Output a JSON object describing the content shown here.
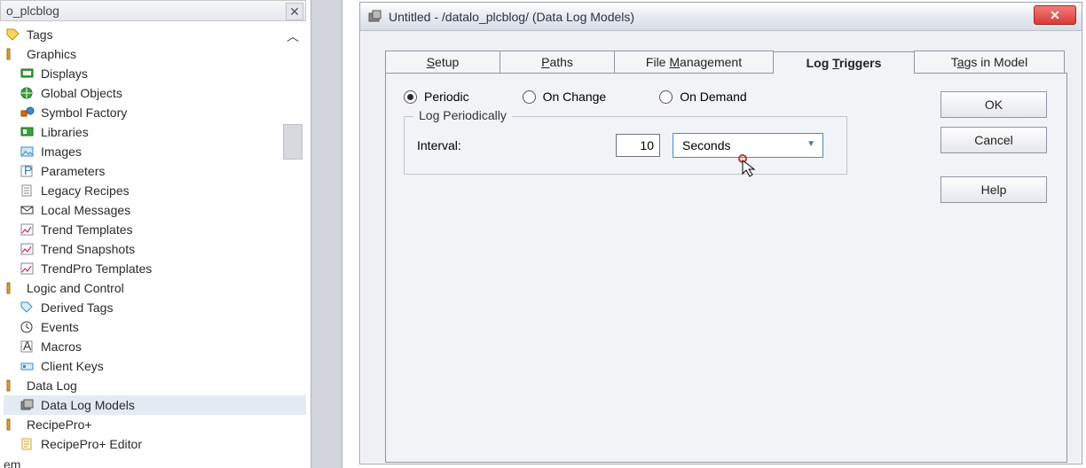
{
  "left_pane": {
    "title": "o_plcblog",
    "items": [
      {
        "label": "Tags",
        "indent": false,
        "icon": "tag"
      },
      {
        "label": "Graphics",
        "indent": false,
        "icon": "folder"
      },
      {
        "label": "Displays",
        "indent": true,
        "icon": "display"
      },
      {
        "label": "Global Objects",
        "indent": true,
        "icon": "globe"
      },
      {
        "label": "Symbol Factory",
        "indent": true,
        "icon": "shapes"
      },
      {
        "label": "Libraries",
        "indent": true,
        "icon": "lib"
      },
      {
        "label": "Images",
        "indent": true,
        "icon": "image"
      },
      {
        "label": "Parameters",
        "indent": true,
        "icon": "param"
      },
      {
        "label": "Legacy Recipes",
        "indent": true,
        "icon": "recipe"
      },
      {
        "label": "Local Messages",
        "indent": true,
        "icon": "msg"
      },
      {
        "label": "Trend Templates",
        "indent": true,
        "icon": "trend"
      },
      {
        "label": "Trend Snapshots",
        "indent": true,
        "icon": "trend"
      },
      {
        "label": "TrendPro Templates",
        "indent": true,
        "icon": "trend"
      },
      {
        "label": "Logic and Control",
        "indent": false,
        "icon": "folder"
      },
      {
        "label": "Derived Tags",
        "indent": true,
        "icon": "dtag"
      },
      {
        "label": "Events",
        "indent": true,
        "icon": "clock"
      },
      {
        "label": "Macros",
        "indent": true,
        "icon": "macro"
      },
      {
        "label": "Client Keys",
        "indent": true,
        "icon": "key"
      },
      {
        "label": "Data Log",
        "indent": false,
        "icon": "folder"
      },
      {
        "label": "Data Log Models",
        "indent": true,
        "icon": "log",
        "selected": true
      },
      {
        "label": "RecipePro+",
        "indent": false,
        "icon": "folder"
      },
      {
        "label": "RecipePro+ Editor",
        "indent": true,
        "icon": "editor"
      }
    ],
    "truncated_last": "em"
  },
  "dialog": {
    "title": "Untitled - /datalo_plcblog/ (Data Log Models)",
    "close_glyph": "✕",
    "tabs": {
      "setup": {
        "pre": "",
        "u": "S",
        "post": "etup"
      },
      "paths": {
        "pre": "",
        "u": "P",
        "post": "aths"
      },
      "file_mgmt": {
        "pre": "File ",
        "u": "M",
        "post": "anagement"
      },
      "log_triggers": {
        "pre": "Log ",
        "u": "T",
        "post": "riggers"
      },
      "tags": {
        "pre": "T",
        "u": "a",
        "post": "gs in Model"
      }
    },
    "radios": {
      "periodic": "Periodic",
      "on_change": "On Change",
      "on_demand": "On Demand",
      "selected": "periodic"
    },
    "group": {
      "legend": "Log Periodically",
      "interval_label": "Interval:",
      "interval_value": "10",
      "interval_unit": "Seconds"
    },
    "buttons": {
      "ok": "OK",
      "cancel": "Cancel",
      "help": "Help"
    }
  }
}
